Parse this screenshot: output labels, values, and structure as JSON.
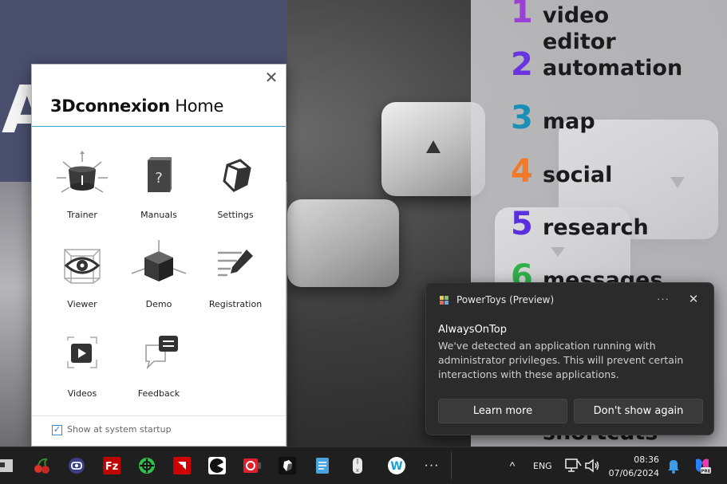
{
  "wallpaper": {
    "big_letter": "A",
    "list": [
      {
        "num": "1",
        "text": "video",
        "color": "#9b3fd6"
      },
      {
        "num": "",
        "text": "editor",
        "color": "#7a3fd6"
      },
      {
        "num": "2",
        "text": "automation",
        "color": "#6a35e0"
      },
      {
        "num": "3",
        "text": "map",
        "color": "#1c8fb4"
      },
      {
        "num": "4",
        "text": "social",
        "color": "#f07a2a"
      },
      {
        "num": "5",
        "text": "research",
        "color": "#5a2fe0"
      },
      {
        "num": "6",
        "text": "messages",
        "color": "#2fb04a"
      },
      {
        "num": "",
        "text": "shortcuts",
        "color": "#2fb04a"
      }
    ]
  },
  "cx_window": {
    "brand": "3Dconnexion",
    "home": " Home",
    "close_glyph": "✕",
    "tiles": [
      {
        "label": "Trainer"
      },
      {
        "label": "Manuals"
      },
      {
        "label": "Settings"
      },
      {
        "label": "Viewer"
      },
      {
        "label": "Demo"
      },
      {
        "label": "Registration"
      },
      {
        "label": "Videos"
      },
      {
        "label": "Feedback"
      }
    ],
    "startup_checked_glyph": "✓",
    "startup_label": "Show at system startup"
  },
  "toast": {
    "app_name": "PowerToys (Preview)",
    "more_glyph": "···",
    "close_glyph": "✕",
    "heading": "AlwaysOnTop",
    "body": "We've detected an application running with administrator privileges. This will prevent certain interactions with these applications.",
    "learn_more": "Learn more",
    "dont_show": "Don't show again"
  },
  "taskbar": {
    "language": "ENG",
    "time": "08:36",
    "date": "07/06/2024",
    "more_glyph": "···",
    "chevron_glyph": "^",
    "accent_color": "#0078d4"
  }
}
